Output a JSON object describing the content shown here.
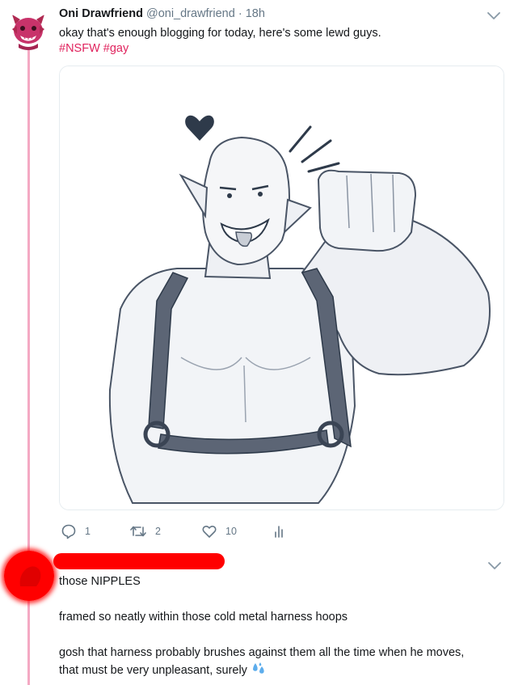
{
  "tweet": {
    "author_name": "Oni Drawfriend",
    "author_handle": "@oni_drawfriend",
    "separator": "·",
    "time": "18h",
    "text": "okay that's enough blogging for today, here's some lewd guys.",
    "hashtags": [
      "#NSFW",
      "#gay"
    ],
    "stats": {
      "replies": "1",
      "retweets": "2",
      "likes": "10"
    }
  },
  "reply": {
    "author_redacted": true,
    "paragraphs": [
      "those NIPPLES",
      "framed so neatly within those cold metal harness hoops",
      "gosh that harness probably brushes against them all the time when he moves,",
      "that must be very unpleasant, surely"
    ],
    "emoji": "sweat-droplets"
  },
  "colors": {
    "thread_line": "#f4a9c3",
    "hashtag": "#e0245e",
    "muted": "#657786",
    "avatar_1": "#b02a52",
    "redaction": "#ff0000"
  }
}
